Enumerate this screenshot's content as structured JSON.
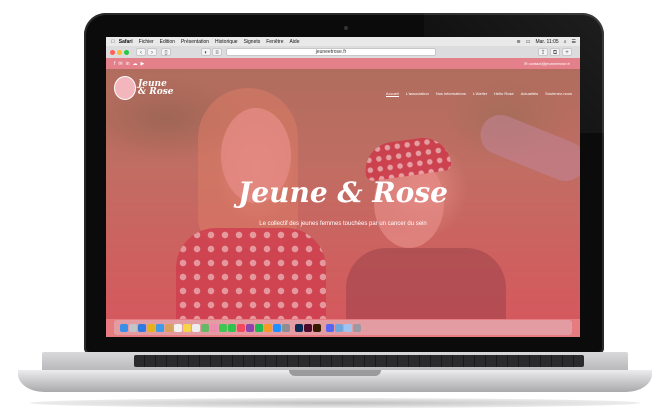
{
  "menubar": {
    "apple": "",
    "items": [
      "Safari",
      "Fichier",
      "Edition",
      "Présentation",
      "Historique",
      "Signets",
      "Fenêtre",
      "Aide"
    ],
    "clock": "Mar. 11:05",
    "status_icons": [
      "wifi-icon",
      "battery-icon",
      "spotlight-icon",
      "menu-icon"
    ]
  },
  "browser": {
    "url": "jeuneetrose.fr"
  },
  "site": {
    "social_icons": [
      "f",
      "✉",
      "in",
      "☁",
      "▶"
    ],
    "contact": "✉ contact@jeuneetrose.fr",
    "logo": "Jeune & Rose",
    "nav": [
      "Accueil",
      "L'association",
      "Nos informations",
      "L'Atelier",
      "Hello Rose",
      "Actualités",
      "Soutenez-nous"
    ],
    "hero_title": "Jeune & Rose",
    "hero_subtitle": "Le collectif des jeunes femmes touchées par un cancer du sein"
  },
  "colors": {
    "overlay": "#d65660",
    "accent": "#e3808a",
    "band": "#e67c80"
  },
  "dock_icons": [
    "finder-icon",
    "launchpad-icon",
    "safari-icon",
    "chrome-icon",
    "mail-icon",
    "contacts-icon",
    "calendar-icon",
    "notes-icon",
    "reminders-icon",
    "maps-icon",
    "photos-icon",
    "messages-icon",
    "facetime-icon",
    "music-icon",
    "podcasts-icon",
    "spotify-icon",
    "books-icon",
    "appstore-icon",
    "preferences-icon",
    "photoshop-icon",
    "indesign-icon",
    "illustrator-icon",
    "other-app-icon",
    "folder-icon",
    "downloads-icon",
    "trash-icon"
  ]
}
